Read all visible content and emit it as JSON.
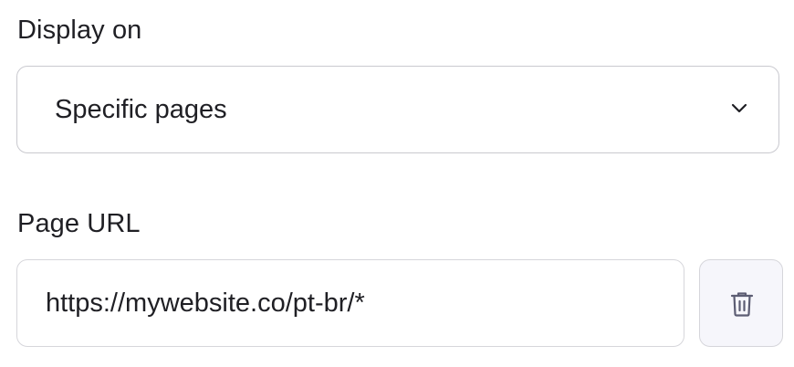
{
  "display_on": {
    "label": "Display on",
    "selected_value": "Specific pages",
    "dropdown_icon": "chevron-down-icon"
  },
  "page_url": {
    "label": "Page URL",
    "value": "https://mywebsite.co/pt-br/*",
    "delete_icon": "trash-icon"
  },
  "colors": {
    "text": "#1f1f24",
    "border": "#c9c9cf",
    "button_bg": "#f6f6fb",
    "icon": "#5c5d73"
  }
}
